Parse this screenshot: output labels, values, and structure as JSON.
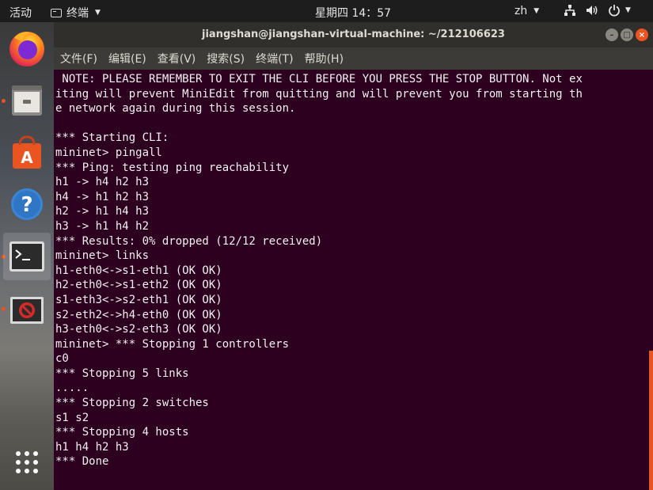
{
  "topbar": {
    "activities": "活动",
    "app_name": "终端",
    "clock": "星期四 14：57",
    "lang": "zh"
  },
  "dock": {
    "items": [
      {
        "name": "firefox-icon"
      },
      {
        "name": "files-icon"
      },
      {
        "name": "software-center-icon"
      },
      {
        "name": "help-icon"
      },
      {
        "name": "terminal-icon"
      },
      {
        "name": "blocked-app-icon"
      },
      {
        "name": "show-applications-icon"
      }
    ]
  },
  "window": {
    "title": "jiangshan@jiangshan-virtual-machine: ~/212106623",
    "menu": [
      "文件(F)",
      "编辑(E)",
      "查看(V)",
      "搜索(S)",
      "终端(T)",
      "帮助(H)"
    ]
  },
  "terminal": {
    "lines": [
      " NOTE: PLEASE REMEMBER TO EXIT THE CLI BEFORE YOU PRESS THE STOP BUTTON. Not ex",
      "iting will prevent MiniEdit from quitting and will prevent you from starting th",
      "e network again during this session.",
      "",
      "*** Starting CLI:",
      "mininet> pingall",
      "*** Ping: testing ping reachability",
      "h1 -> h4 h2 h3",
      "h4 -> h1 h2 h3",
      "h2 -> h1 h4 h3",
      "h3 -> h1 h4 h2",
      "*** Results: 0% dropped (12/12 received)",
      "mininet> links",
      "h1-eth0<->s1-eth1 (OK OK)",
      "h2-eth0<->s1-eth2 (OK OK)",
      "s1-eth3<->s2-eth1 (OK OK)",
      "s2-eth2<->h4-eth0 (OK OK)",
      "h3-eth0<->s2-eth3 (OK OK)",
      "mininet> *** Stopping 1 controllers",
      "c0",
      "*** Stopping 5 links",
      ".....",
      "*** Stopping 2 switches",
      "s1 s2",
      "*** Stopping 4 hosts",
      "h1 h4 h2 h3",
      "*** Done"
    ]
  },
  "colors": {
    "terminal_bg": "#2c001e",
    "accent": "#e95420"
  }
}
